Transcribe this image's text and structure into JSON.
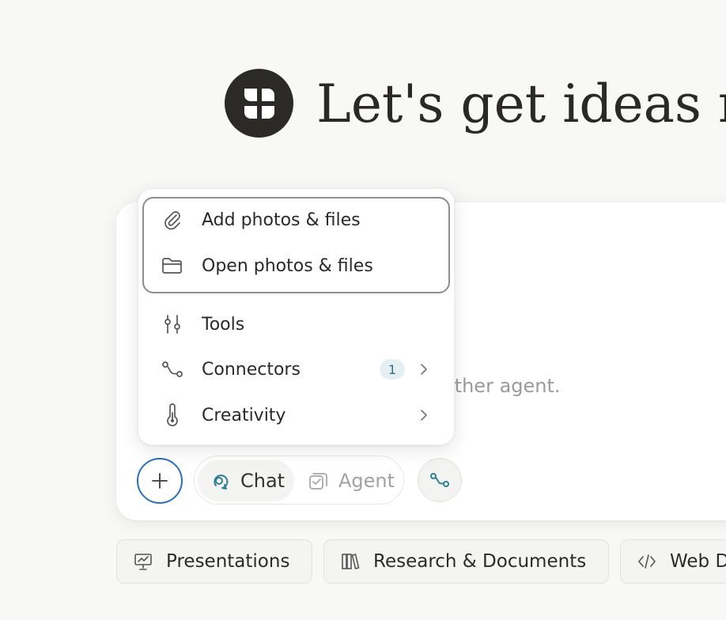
{
  "header": {
    "headline": "Let's get ideas n",
    "logo_icon": "brand-logo-icon"
  },
  "composer": {
    "placeholder_partial": "other agent."
  },
  "menu": {
    "items": [
      {
        "label": "Add photos & files",
        "icon": "paperclip-icon"
      },
      {
        "label": "Open photos & files",
        "icon": "folder-icon"
      },
      {
        "label": "Tools",
        "icon": "sliders-icon"
      },
      {
        "label": "Connectors",
        "icon": "connector-icon",
        "badge": "1",
        "has_submenu": true
      },
      {
        "label": "Creativity",
        "icon": "thermometer-icon",
        "has_submenu": true
      }
    ]
  },
  "toolbar": {
    "plus_icon": "plus-icon",
    "modes": [
      {
        "label": "Chat",
        "icon": "chat-icon",
        "selected": true
      },
      {
        "label": "Agent",
        "icon": "agent-check-icon",
        "selected": false
      }
    ],
    "connector_icon": "connector-icon"
  },
  "chips": [
    {
      "label": "Presentations",
      "icon": "presentation-icon"
    },
    {
      "label": "Research & Documents",
      "icon": "books-icon"
    },
    {
      "label": "Web D",
      "icon": "code-icon"
    }
  ],
  "colors": {
    "background": "#f8f8f7",
    "plus_ring": "#2a6ec2",
    "connector_accent": "#2f7f95",
    "badge_bg": "#e6f0f2",
    "badge_text": "#2f6f83"
  }
}
